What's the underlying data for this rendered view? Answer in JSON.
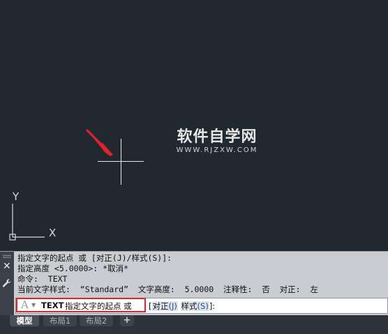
{
  "watermark": {
    "title": "软件自学网",
    "url": "WWW.RJZXW.COM"
  },
  "ucs": {
    "y_label": "Y",
    "x_label": "X"
  },
  "command_history": [
    "指定文字的起点 或 [对正(J)/样式(S)]:",
    "指定高度 <5.0000>: *取消*",
    "命令:  TEXT",
    "当前文字样式:  “Standard”  文字高度:  5.0000  注释性:  否  对正:  左"
  ],
  "command_input": {
    "command": "TEXT",
    "prompt": "指定文字的起点 或",
    "bracket_open": "[",
    "option1_label": "对正",
    "option1_key": "(J)",
    "option2_label": "样式",
    "option2_key": "(S)",
    "bracket_close": "]:"
  },
  "tabs": [
    "模型",
    "布局1",
    "布局2",
    "+"
  ],
  "colors": {
    "canvas_bg": "#212830",
    "highlight": "#e0242a",
    "arrow": "#e0242a"
  },
  "icons": {
    "close": "close-icon",
    "settings": "wrench-icon",
    "text_style": "text-a-icon",
    "dropdown": "chevron-down-icon"
  }
}
